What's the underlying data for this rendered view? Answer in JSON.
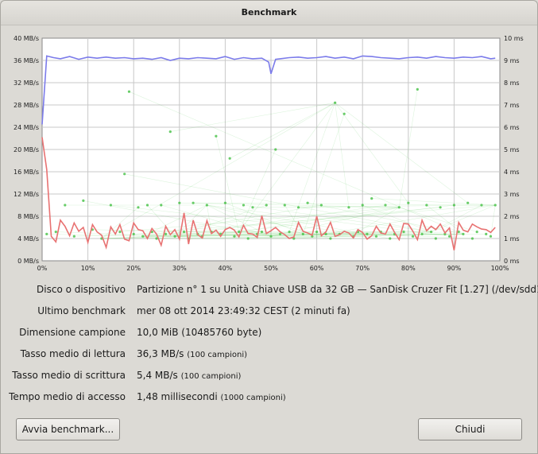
{
  "window": {
    "title": "Benchmark"
  },
  "chart_data": {
    "type": "line",
    "x_ticks": [
      "0%",
      "10%",
      "20%",
      "30%",
      "40%",
      "50%",
      "60%",
      "70%",
      "80%",
      "90%",
      "100%"
    ],
    "y_left_ticks": [
      "0 MB/s",
      "4 MB/s",
      "8 MB/s",
      "12 MB/s",
      "16 MB/s",
      "20 MB/s",
      "24 MB/s",
      "28 MB/s",
      "32 MB/s",
      "36 MB/s",
      "40 MB/s"
    ],
    "y_right_ticks": [
      "0 ms",
      "1 ms",
      "2 ms",
      "3 ms",
      "4 ms",
      "5 ms",
      "6 ms",
      "7 ms",
      "8 ms",
      "9 ms",
      "10 ms"
    ],
    "ylim_left": [
      0,
      40
    ],
    "ylim_right": [
      0,
      10
    ],
    "xlim": [
      0,
      100
    ],
    "grid": true,
    "series": [
      {
        "color": "#7b7bea",
        "x": [
          0,
          1,
          2.5,
          4,
          6,
          8,
          10,
          12,
          14,
          16,
          18,
          20,
          22,
          24,
          26,
          28,
          30,
          32,
          34,
          36,
          38,
          40,
          42,
          44,
          46,
          48,
          49.5,
          50,
          51,
          52,
          54,
          56,
          58,
          60,
          62,
          64,
          66,
          68,
          70,
          72,
          74,
          76,
          78,
          80,
          82,
          84,
          86,
          88,
          90,
          92,
          94,
          96,
          98,
          99
        ],
        "values": [
          24.5,
          36.8,
          36.5,
          36.3,
          36.7,
          36.2,
          36.6,
          36.4,
          36.6,
          36.4,
          36.5,
          36.3,
          36.4,
          36.2,
          36.5,
          36.0,
          36.4,
          36.3,
          36.5,
          36.4,
          36.3,
          36.7,
          36.2,
          36.5,
          36.3,
          36.4,
          35.7,
          33.6,
          36.2,
          36.3,
          36.5,
          36.6,
          36.4,
          36.5,
          36.7,
          36.4,
          36.6,
          36.3,
          36.8,
          36.7,
          36.5,
          36.4,
          36.3,
          36.5,
          36.6,
          36.4,
          36.7,
          36.5,
          36.4,
          36.6,
          36.5,
          36.7,
          36.3,
          36.4
        ]
      },
      {
        "color": "#e87272",
        "x": [
          0,
          1,
          2,
          3,
          4,
          5,
          6,
          7,
          8,
          9,
          10,
          11,
          12,
          13,
          14,
          15,
          16,
          17,
          18,
          19,
          20,
          21,
          22,
          23,
          24,
          25,
          26,
          27,
          28,
          29,
          30,
          31,
          32,
          33,
          34,
          35,
          36,
          37,
          38,
          39,
          40,
          41,
          42,
          43,
          44,
          45,
          46,
          47,
          48,
          49,
          50,
          51,
          52,
          53,
          54,
          55,
          56,
          57,
          58,
          59,
          60,
          61,
          62,
          63,
          64,
          65,
          66,
          67,
          68,
          69,
          70,
          71,
          72,
          73,
          74,
          75,
          76,
          77,
          78,
          79,
          80,
          81,
          82,
          83,
          84,
          85,
          86,
          87,
          88,
          89,
          90,
          91,
          92,
          93,
          94,
          95,
          96,
          97,
          98,
          99
        ],
        "values": [
          22.2,
          16.4,
          4.4,
          3.4,
          7.3,
          6.2,
          4.5,
          6.8,
          5.3,
          6.0,
          3.3,
          6.5,
          5.2,
          4.6,
          2.4,
          6.1,
          4.8,
          6.5,
          3.9,
          3.6,
          6.8,
          5.6,
          5.4,
          4.0,
          5.8,
          4.8,
          2.8,
          6.2,
          4.7,
          5.6,
          3.9,
          8.6,
          3.0,
          7.3,
          4.7,
          4.1,
          7.2,
          4.9,
          5.5,
          4.4,
          5.6,
          6.0,
          5.5,
          4.3,
          6.4,
          4.9,
          4.8,
          4.2,
          8.1,
          4.9,
          5.4,
          6.0,
          5.2,
          4.7,
          4.0,
          4.3,
          6.9,
          5.3,
          5.0,
          4.6,
          8.0,
          4.5,
          5.2,
          6.9,
          4.4,
          4.7,
          5.3,
          5.0,
          4.1,
          5.6,
          5.1,
          3.9,
          4.5,
          6.2,
          5.0,
          4.8,
          6.6,
          5.1,
          3.8,
          6.7,
          6.6,
          5.3,
          3.8,
          7.3,
          5.4,
          6.2,
          5.6,
          6.6,
          5.0,
          5.9,
          1.9,
          6.9,
          5.5,
          5.2,
          6.6,
          6.1,
          5.7,
          5.6,
          5.1,
          6.0
        ]
      },
      {
        "color": "#43c043",
        "axis": "right",
        "x": [
          1,
          3,
          5,
          7,
          9,
          11,
          13,
          15,
          17,
          18,
          19,
          20,
          21,
          22,
          23,
          24,
          25,
          26,
          27,
          28,
          29,
          30,
          31,
          32,
          33,
          34,
          35,
          36,
          37,
          38,
          39,
          40,
          41,
          42,
          43,
          44,
          45,
          46,
          47,
          48,
          49,
          50,
          51,
          52,
          53,
          54,
          55,
          56,
          57,
          58,
          59,
          60,
          61,
          62,
          63,
          64,
          65,
          66,
          67,
          68,
          69,
          70,
          71,
          72,
          73,
          74,
          75,
          76,
          77,
          78,
          79,
          80,
          81,
          82,
          83,
          84,
          85,
          86,
          87,
          88,
          89,
          90,
          91,
          92,
          93,
          94,
          95,
          96,
          97,
          98,
          99
        ],
        "values": [
          1.2,
          1.3,
          2.5,
          1.1,
          2.7,
          1.4,
          1.0,
          2.5,
          1.3,
          3.9,
          7.6,
          1.2,
          2.4,
          1.1,
          2.5,
          1.3,
          1.0,
          2.5,
          1.2,
          5.8,
          1.1,
          2.6,
          1.3,
          1.0,
          2.6,
          1.2,
          1.1,
          2.5,
          1.3,
          5.6,
          1.2,
          2.6,
          4.6,
          1.1,
          1.3,
          2.5,
          1.0,
          2.4,
          1.2,
          1.3,
          2.5,
          1.1,
          5.0,
          1.2,
          2.5,
          1.3,
          1.0,
          2.4,
          1.2,
          2.6,
          1.1,
          1.3,
          2.5,
          1.2,
          1.0,
          7.1,
          1.2,
          6.6,
          2.4,
          1.1,
          1.3,
          2.5,
          1.2,
          2.8,
          1.1,
          1.3,
          2.5,
          1.0,
          1.2,
          2.4,
          1.3,
          2.6,
          1.1,
          7.7,
          1.2,
          2.5,
          1.3,
          1.0,
          2.4,
          1.2,
          1.1,
          2.5,
          1.3,
          1.2,
          2.6,
          1.0,
          1.3,
          2.5,
          1.2,
          1.1,
          2.5
        ]
      }
    ]
  },
  "info": [
    {
      "label": "Disco o dispositivo",
      "value": "Partizione n° 1 su Unità Chiave USB da 32 GB — SanDisk Cruzer Fit [1.27] (/dev/sdd1)",
      "note": ""
    },
    {
      "label": "Ultimo benchmark",
      "value": "mer 08 ott 2014 23:49:32 CEST (2 minuti fa)",
      "note": ""
    },
    {
      "label": "Dimensione campione",
      "value": "10,0 MiB (10485760 byte)",
      "note": ""
    },
    {
      "label": "Tasso medio di lettura",
      "value": "36,3 MB/s",
      "note": "(100 campioni)"
    },
    {
      "label": "Tasso medio di scrittura",
      "value": "5,4 MB/s",
      "note": "(100 campioni)"
    },
    {
      "label": "Tempo medio di accesso",
      "value": "1,48 millisecondi",
      "note": "(1000 campioni)"
    }
  ],
  "buttons": {
    "start_label": "Avvia benchmark...",
    "close_label": "Chiudi"
  }
}
